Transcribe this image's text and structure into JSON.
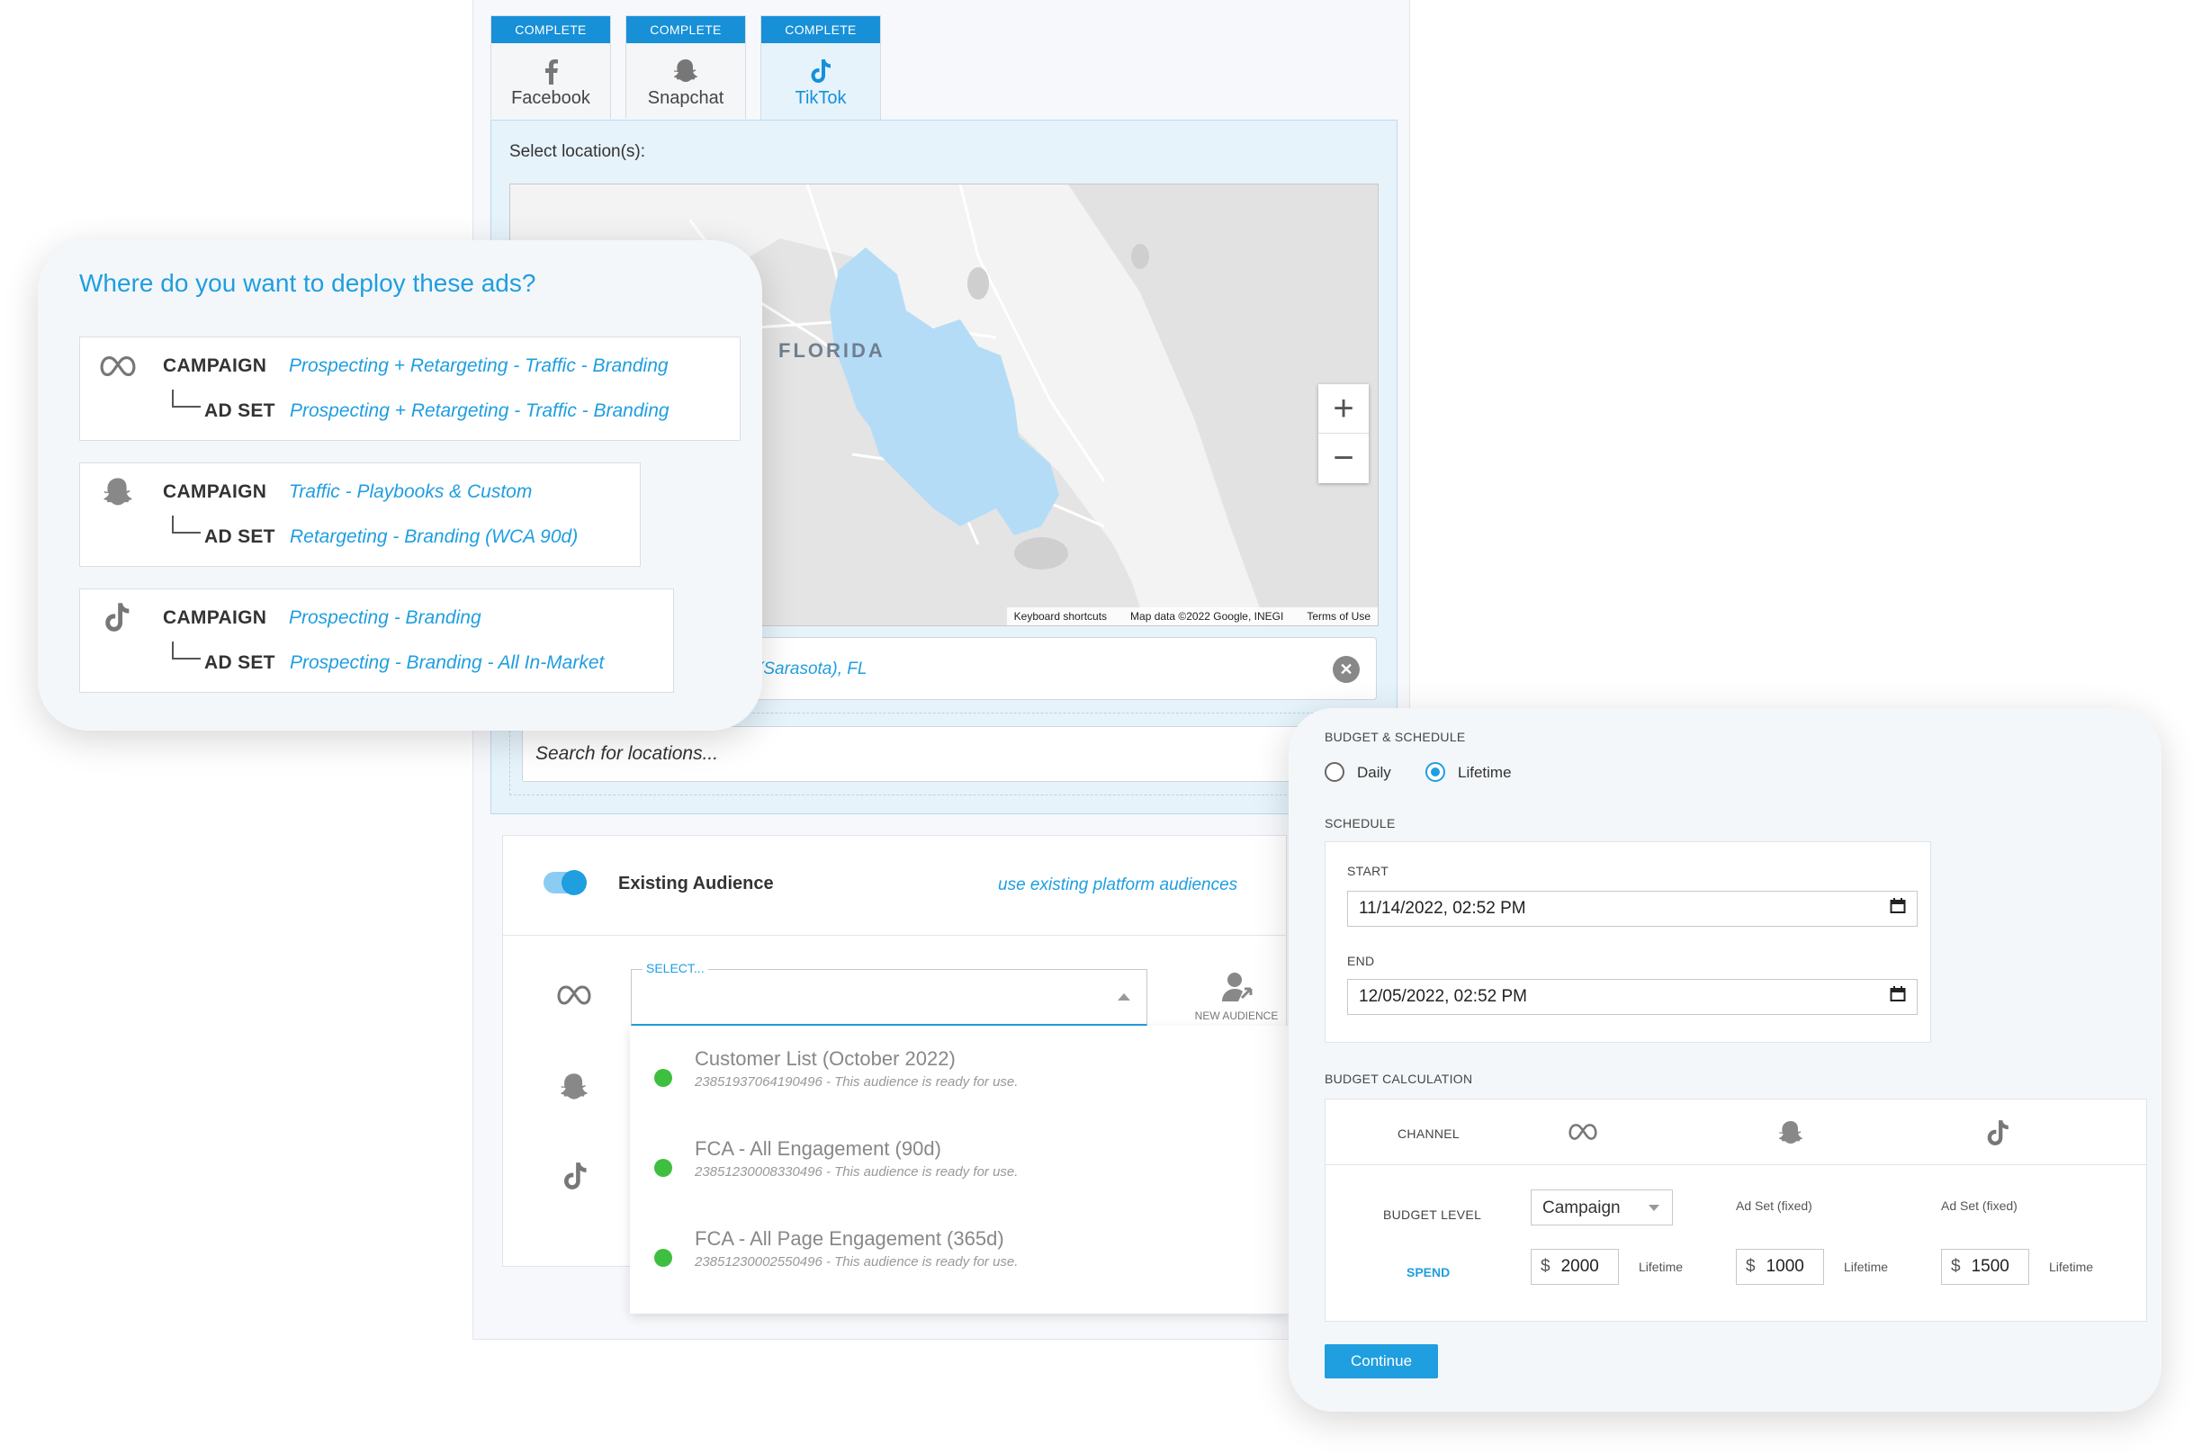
{
  "tabs": [
    {
      "status": "COMPLETE",
      "label": "Facebook"
    },
    {
      "status": "COMPLETE",
      "label": "Snapchat"
    },
    {
      "status": "COMPLETE",
      "label": "TikTok"
    }
  ],
  "location": {
    "prompt": "Select location(s):",
    "map_label": "FLORIDA",
    "map_footer": {
      "shortcuts": "Keyboard shortcuts",
      "data": "Map data ©2022 Google, INEGI",
      "terms": "Terms of Use"
    },
    "zoom_in": "+",
    "zoom_out": "−",
    "selected_partial": "(Sarasota), FL",
    "search_placeholder": "Search for locations..."
  },
  "audience": {
    "title": "Existing Audience",
    "hint": "use existing platform audiences",
    "select_label": "SELECT...",
    "new_audience": "NEW AUDIENCE",
    "items": [
      {
        "name": "Customer List (October 2022)",
        "sub": "23851937064190496 - This audience is ready for use."
      },
      {
        "name": "FCA - All Engagement (90d)",
        "sub": "23851230008330496 - This audience is ready for use."
      },
      {
        "name": "FCA - All Page Engagement (365d)",
        "sub": "23851230002550496 - This audience is ready for use."
      }
    ]
  },
  "deploy": {
    "title": "Where do you want to deploy these ads?",
    "campaign_kw": "CAMPAIGN",
    "adset_kw": "AD SET",
    "platforms": [
      {
        "icon": "meta-icon",
        "campaign": "Prospecting + Retargeting - Traffic - Branding",
        "adset": "Prospecting + Retargeting - Traffic - Branding"
      },
      {
        "icon": "snapchat-icon",
        "campaign": "Traffic - Playbooks & Custom",
        "adset": "Retargeting - Branding (WCA 90d)"
      },
      {
        "icon": "tiktok-icon",
        "campaign": "Prospecting - Branding",
        "adset": "Prospecting - Branding - All In-Market"
      }
    ]
  },
  "budget": {
    "section": "BUDGET & SCHEDULE",
    "daily": "Daily",
    "lifetime": "Lifetime",
    "selected": "Lifetime",
    "schedule": "SCHEDULE",
    "start_label": "START",
    "start_value": "11/14/2022, 02:52 PM",
    "end_label": "END",
    "end_value": "12/05/2022, 02:52 PM",
    "calc": "BUDGET CALCULATION",
    "channel": "CHANNEL",
    "level_label": "BUDGET LEVEL",
    "level_value": "Campaign",
    "adset_fixed": "Ad Set (fixed)",
    "spend_label": "SPEND",
    "currency": "$",
    "period": "Lifetime",
    "spends": [
      "2000",
      "1000",
      "1500"
    ],
    "continue": "Continue"
  },
  "colors": {
    "accent": "#1f9ee0",
    "tab_status": "#1790d8",
    "ready": "#3fbf3f",
    "map_region": "#b5dcf6"
  }
}
